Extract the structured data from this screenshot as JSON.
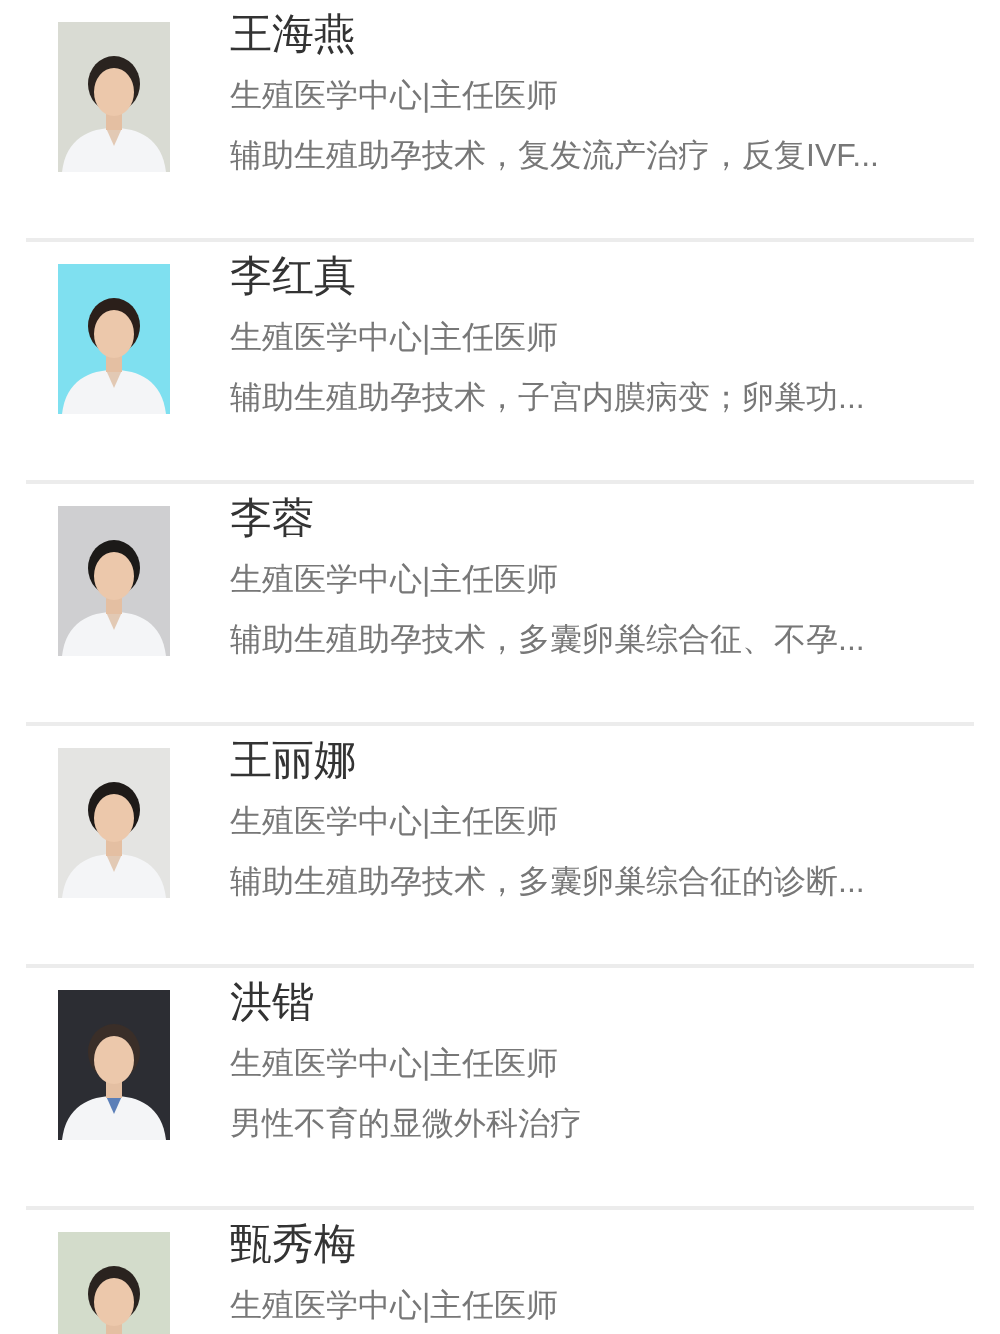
{
  "doctors": [
    {
      "name": "王海燕",
      "department": "生殖医学中心|主任医师",
      "specialty": "辅助生殖助孕技术，复发流产治疗，反复IVF..."
    },
    {
      "name": "李红真",
      "department": "生殖医学中心|主任医师",
      "specialty": "辅助生殖助孕技术，子宫内膜病变；卵巢功..."
    },
    {
      "name": "李蓉",
      "department": "生殖医学中心|主任医师",
      "specialty": "辅助生殖助孕技术，多囊卵巢综合征、不孕..."
    },
    {
      "name": "王丽娜",
      "department": "生殖医学中心|主任医师",
      "specialty": "辅助生殖助孕技术，多囊卵巢综合征的诊断..."
    },
    {
      "name": "洪锴",
      "department": "生殖医学中心|主任医师",
      "specialty": "男性不育的显微外科治疗"
    },
    {
      "name": "甄秀梅",
      "department": "生殖医学中心|主任医师"
    }
  ]
}
